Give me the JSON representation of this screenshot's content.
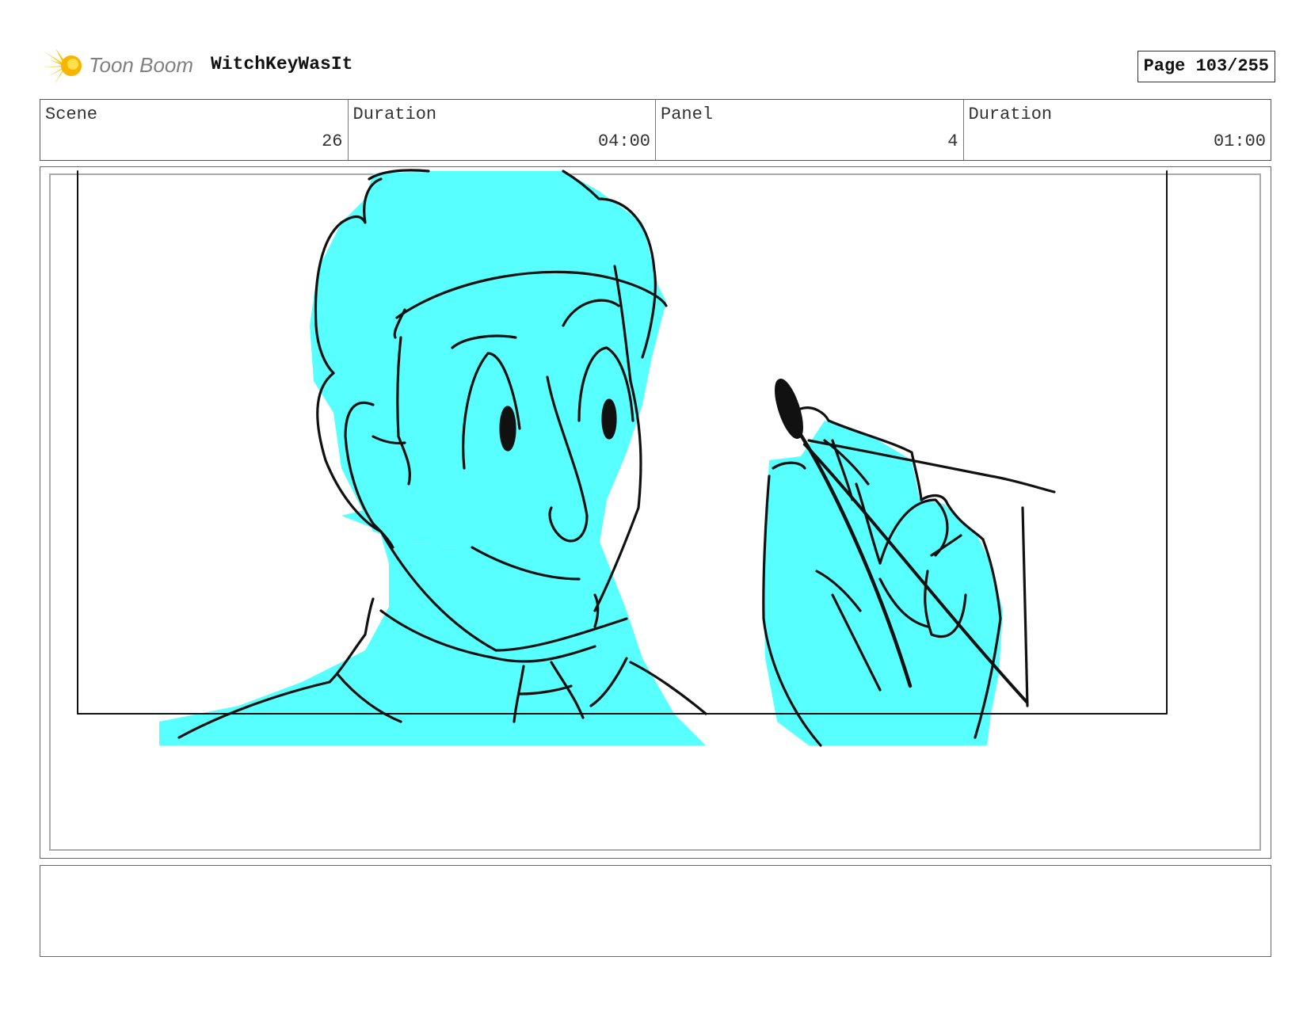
{
  "header": {
    "logo_text": "Toon Boom",
    "project_name": "WitchKeyWasIt",
    "page_label": "Page 103/255"
  },
  "info": {
    "scene_label": "Scene",
    "scene_value": "26",
    "scene_duration_label": "Duration",
    "scene_duration_value": "04:00",
    "panel_label": "Panel",
    "panel_value": "4",
    "panel_duration_label": "Duration",
    "panel_duration_value": "01:00"
  },
  "colors": {
    "sketch_fill": "#57ffff",
    "logo_accent": "#f5c400",
    "ink": "#111111"
  },
  "icons": {
    "logo": "toon-boom-starburst-icon"
  },
  "notes": {
    "text": ""
  }
}
